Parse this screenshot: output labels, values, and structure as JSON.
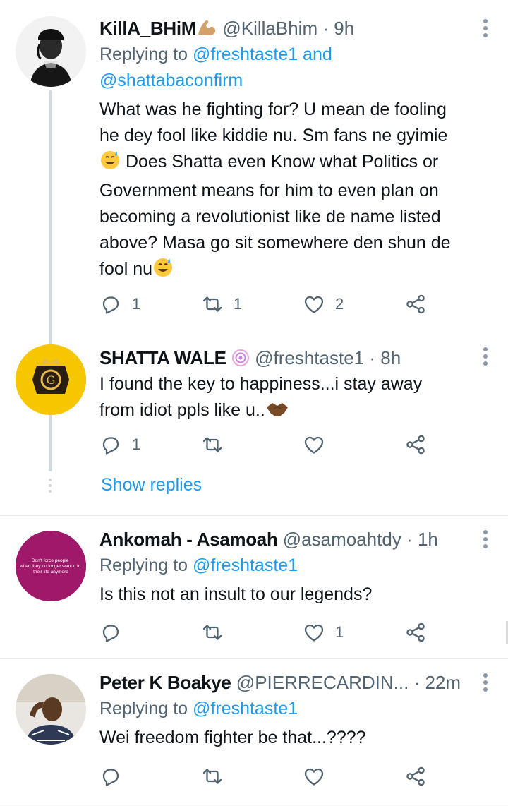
{
  "tweets": [
    {
      "name": "KillA_BHiM",
      "handle": "@KillaBhim",
      "time": "9h",
      "replying_prefix": "Replying to ",
      "replying_line1": "@freshtaste1 and",
      "replying_line2": "@shattabaconfirm",
      "body_lines": [
        "What was he fighting for? U mean de fooling",
        "he dey fool like kiddie nu. Sm fans ne gyimie",
        "Does Shatta even Know what Politics or",
        "Government means for him to even plan on",
        "becoming a revolutionist like de name listed",
        "above? Masa go sit somewhere den shun de",
        "fool nu"
      ],
      "reply_count": "1",
      "retweet_count": "1",
      "like_count": "2"
    },
    {
      "name": "SHATTA WALE",
      "handle": "@freshtaste1",
      "time": "8h",
      "body_lines": [
        "I found the key to happiness...i stay away",
        "from idiot ppls like u.."
      ],
      "reply_count": "1",
      "retweet_count": "",
      "like_count": "",
      "show_replies": "Show replies"
    },
    {
      "name": "Ankomah - Asamoah",
      "handle": "@asamoahtdy",
      "time": "1h",
      "replying_prefix": "Replying to ",
      "replying_line1": "@freshtaste1",
      "body_lines": [
        "Is this not an insult to our legends?"
      ],
      "avatar_text": [
        "Don't force people",
        "when they no longer want u in",
        "their life anymore"
      ],
      "reply_count": "",
      "retweet_count": "",
      "like_count": "1"
    },
    {
      "name": "Peter K Boakye",
      "handle": "@PIERRECARDIN...",
      "time": "22m",
      "replying_prefix": "Replying to ",
      "replying_line1": "@freshtaste1",
      "body_lines": [
        "Wei freedom fighter be that...????"
      ],
      "reply_count": "",
      "retweet_count": "",
      "like_count": ""
    }
  ],
  "separator": " · ",
  "icons": {
    "reply": "reply-icon",
    "retweet": "retweet-icon",
    "like": "heart-icon",
    "share": "share-icon",
    "more": "more-vertical-icon"
  },
  "colors": {
    "link": "#1d9bf0",
    "secondary": "#536471",
    "divider": "#e6e9eb",
    "thread_line": "#cfd9de",
    "avatar_shatta_bg": "#f6c700",
    "avatar_ankomah_bg": "#a0186a"
  }
}
